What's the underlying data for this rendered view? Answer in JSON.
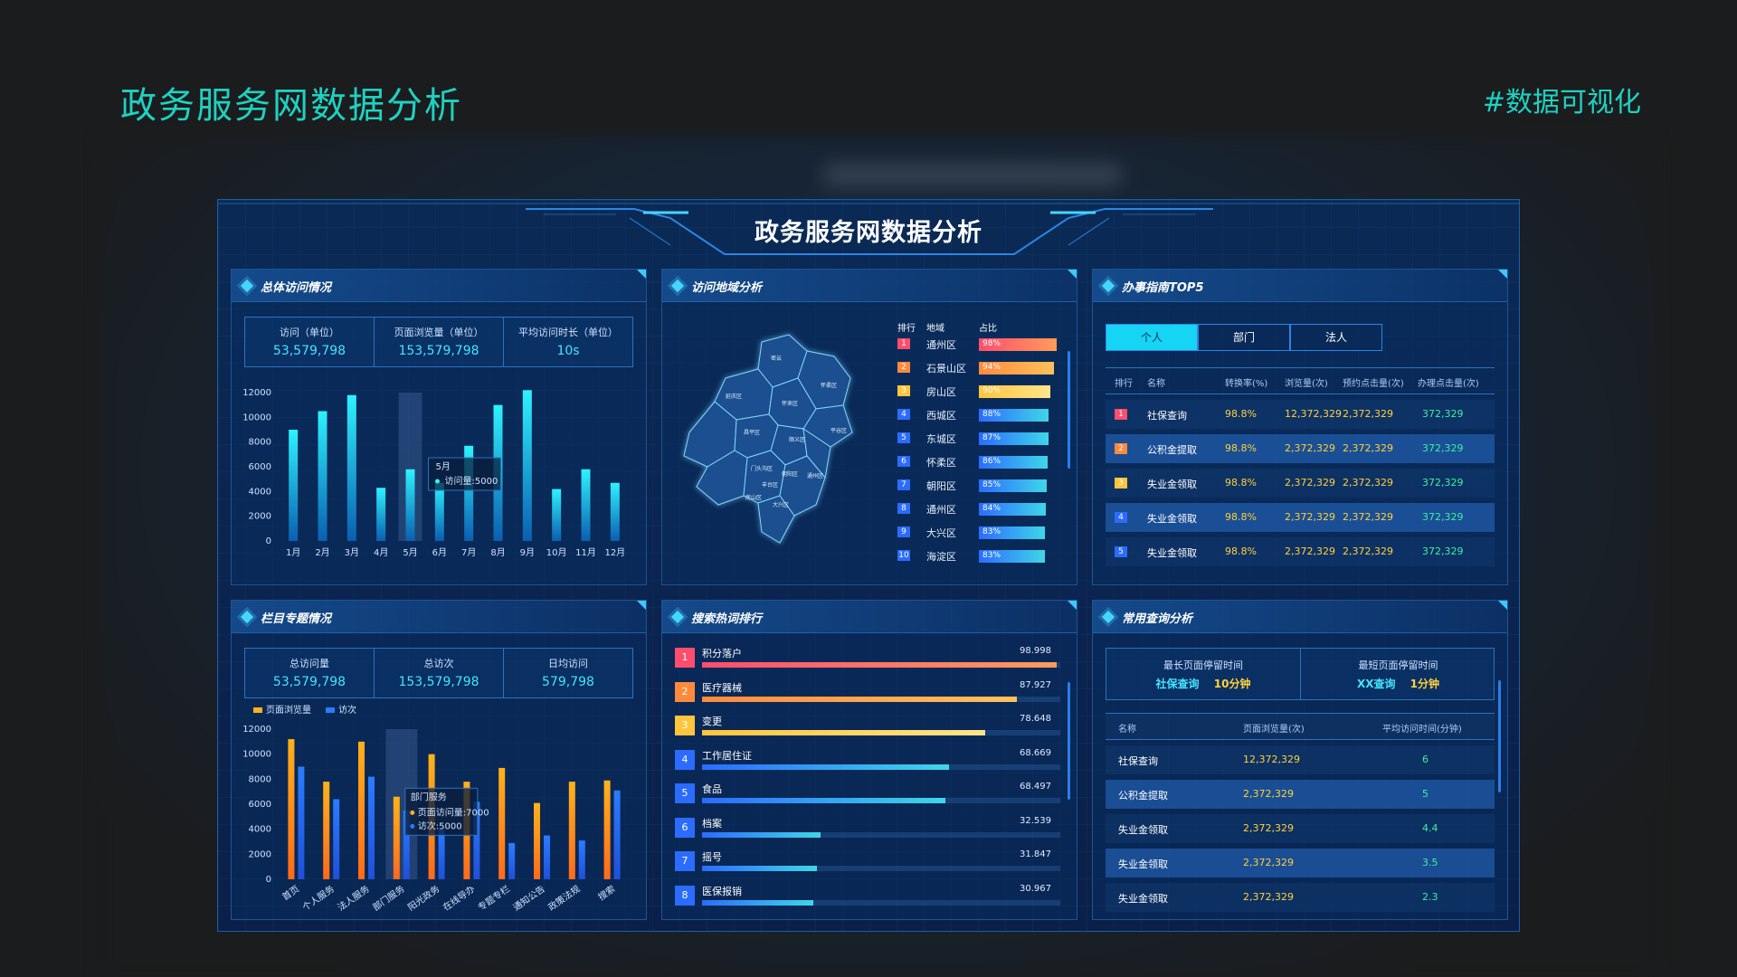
{
  "page": {
    "title": "政务服务网数据分析",
    "tag": "#数据可视化"
  },
  "dashboard": {
    "title": "政务服务网数据分析"
  },
  "overall": {
    "title": "总体访问情况",
    "stats": [
      {
        "label": "访问（单位）",
        "value": "53,579,798"
      },
      {
        "label": "页面浏览量（单位）",
        "value": "153,579,798"
      },
      {
        "label": "平均访问时长（单位）",
        "value": "10s"
      }
    ],
    "tooltip": {
      "title": "5月",
      "text": "访问量:5000"
    }
  },
  "region": {
    "title": "访问地域分析",
    "headers": {
      "rank": "排行",
      "area": "地域",
      "share": "占比"
    },
    "rows": [
      {
        "rank": "1",
        "name": "通州区",
        "pct": "98%",
        "value": 98,
        "color": "#ff4d6d"
      },
      {
        "rank": "2",
        "name": "石景山区",
        "pct": "94%",
        "value": 94,
        "color": "#ff8a3d"
      },
      {
        "rank": "3",
        "name": "房山区",
        "pct": "90%",
        "value": 90,
        "color": "#ffc53d"
      },
      {
        "rank": "4",
        "name": "西城区",
        "pct": "88%",
        "value": 88,
        "color": "#2b6cff"
      },
      {
        "rank": "5",
        "name": "东城区",
        "pct": "87%",
        "value": 87,
        "color": "#2b6cff"
      },
      {
        "rank": "6",
        "name": "怀柔区",
        "pct": "86%",
        "value": 86,
        "color": "#2b6cff"
      },
      {
        "rank": "7",
        "name": "朝阳区",
        "pct": "85%",
        "value": 85,
        "color": "#2b6cff"
      },
      {
        "rank": "8",
        "name": "通州区",
        "pct": "84%",
        "value": 84,
        "color": "#2b6cff"
      },
      {
        "rank": "9",
        "name": "大兴区",
        "pct": "83%",
        "value": 83,
        "color": "#2b6cff"
      },
      {
        "rank": "10",
        "name": "海淀区",
        "pct": "83%",
        "value": 83,
        "color": "#2b6cff"
      }
    ]
  },
  "guide": {
    "title": "办事指南TOP5",
    "tabs": [
      "个人",
      "部门",
      "法人"
    ],
    "headers": [
      "排行",
      "名称",
      "转换率(%)",
      "浏览量(次)",
      "预约点击量(次)",
      "办理点击量(次)"
    ],
    "rows": [
      {
        "rank": "1",
        "name": "社保查询",
        "rate": "98.8%",
        "views": "12,372,329",
        "book": "2,372,329",
        "done": "372,329",
        "color": "#ff4d6d"
      },
      {
        "rank": "2",
        "name": "公积金提取",
        "rate": "98.8%",
        "views": "2,372,329",
        "book": "2,372,329",
        "done": "372,329",
        "color": "#ff8a3d"
      },
      {
        "rank": "3",
        "name": "失业金领取",
        "rate": "98.8%",
        "views": "2,372,329",
        "book": "2,372,329",
        "done": "372,329",
        "color": "#ffc53d"
      },
      {
        "rank": "4",
        "name": "失业金领取",
        "rate": "98.8%",
        "views": "2,372,329",
        "book": "2,372,329",
        "done": "372,329",
        "color": "#2b6cff"
      },
      {
        "rank": "5",
        "name": "失业金领取",
        "rate": "98.8%",
        "views": "2,372,329",
        "book": "2,372,329",
        "done": "372,329",
        "color": "#2b6cff"
      }
    ]
  },
  "column": {
    "title": "栏目专题情况",
    "stats": [
      {
        "label": "总访问量",
        "value": "53,579,798"
      },
      {
        "label": "总访次",
        "value": "153,579,798"
      },
      {
        "label": "日均访问",
        "value": "579,798"
      }
    ],
    "tooltip": {
      "title": "部门服务",
      "line1": "页面访问量:7000",
      "line2": "访次:5000"
    }
  },
  "hotwords": {
    "title": "搜索热词排行",
    "rows": [
      {
        "rank": "1",
        "name": "积分落户",
        "value": "98.998",
        "pct": 0.99,
        "color": "#ff4d6d"
      },
      {
        "rank": "2",
        "name": "医疗器械",
        "value": "87.927",
        "pct": 0.88,
        "color": "#ff8a3d"
      },
      {
        "rank": "3",
        "name": "变更",
        "value": "78.648",
        "pct": 0.79,
        "color": "#ffc53d"
      },
      {
        "rank": "4",
        "name": "工作居住证",
        "value": "68.669",
        "pct": 0.69,
        "color": "#2b6cff"
      },
      {
        "rank": "5",
        "name": "食品",
        "value": "68.497",
        "pct": 0.68,
        "color": "#2b6cff"
      },
      {
        "rank": "6",
        "name": "档案",
        "value": "32.539",
        "pct": 0.33,
        "color": "#2b6cff"
      },
      {
        "rank": "7",
        "name": "摇号",
        "value": "31.847",
        "pct": 0.32,
        "color": "#2b6cff"
      },
      {
        "rank": "8",
        "name": "医保报销",
        "value": "30.967",
        "pct": 0.31,
        "color": "#2b6cff"
      }
    ]
  },
  "query": {
    "title": "常用查询分析",
    "longest": {
      "label": "最长页面停留时间",
      "item": "社保查询",
      "time": "10分钟"
    },
    "shortest": {
      "label": "最短页面停留时间",
      "item": "XX查询",
      "time": "1分钟"
    },
    "headers": [
      "名称",
      "页面浏览量(次)",
      "平均访问时间(分钟)"
    ],
    "rows": [
      {
        "name": "社保查询",
        "views": "12,372,329",
        "avg": "6"
      },
      {
        "name": "公积金提取",
        "views": "2,372,329",
        "avg": "5"
      },
      {
        "name": "失业金领取",
        "views": "2,372,329",
        "avg": "4.4"
      },
      {
        "name": "失业金领取",
        "views": "2,372,329",
        "avg": "3.5"
      },
      {
        "name": "失业金领取",
        "views": "2,372,329",
        "avg": "2.3"
      }
    ]
  },
  "chart_data": [
    {
      "type": "bar",
      "title": "总体访问情况",
      "categories": [
        "1月",
        "2月",
        "3月",
        "4月",
        "5月",
        "6月",
        "7月",
        "8月",
        "9月",
        "10月",
        "11月",
        "12月"
      ],
      "values": [
        9000,
        10500,
        11800,
        4300,
        5800,
        4700,
        7700,
        11000,
        12200,
        4200,
        5800,
        4700
      ],
      "ylim": [
        0,
        12000
      ],
      "yticks": [
        0,
        2000,
        4000,
        6000,
        8000,
        10000,
        12000
      ],
      "highlight": "5月"
    },
    {
      "type": "bar",
      "title": "栏目专题情况",
      "categories": [
        "首页",
        "个人服务",
        "法人服务",
        "部门服务",
        "阳光政务",
        "在线导办",
        "专题专栏",
        "通知公告",
        "政策法规",
        "搜索"
      ],
      "series": [
        {
          "name": "页面浏览量",
          "values": [
            11200,
            7800,
            11000,
            6600,
            10000,
            7800,
            8900,
            6100,
            7800,
            7900
          ],
          "color": "#ffb21a"
        },
        {
          "name": "访次",
          "values": [
            9000,
            6400,
            8200,
            5500,
            4000,
            6200,
            2900,
            3500,
            3100,
            7100
          ],
          "color": "#2b7cff"
        }
      ],
      "ylim": [
        0,
        12000
      ],
      "yticks": [
        0,
        2000,
        4000,
        6000,
        8000,
        10000,
        12000
      ],
      "highlight": "部门服务"
    }
  ]
}
